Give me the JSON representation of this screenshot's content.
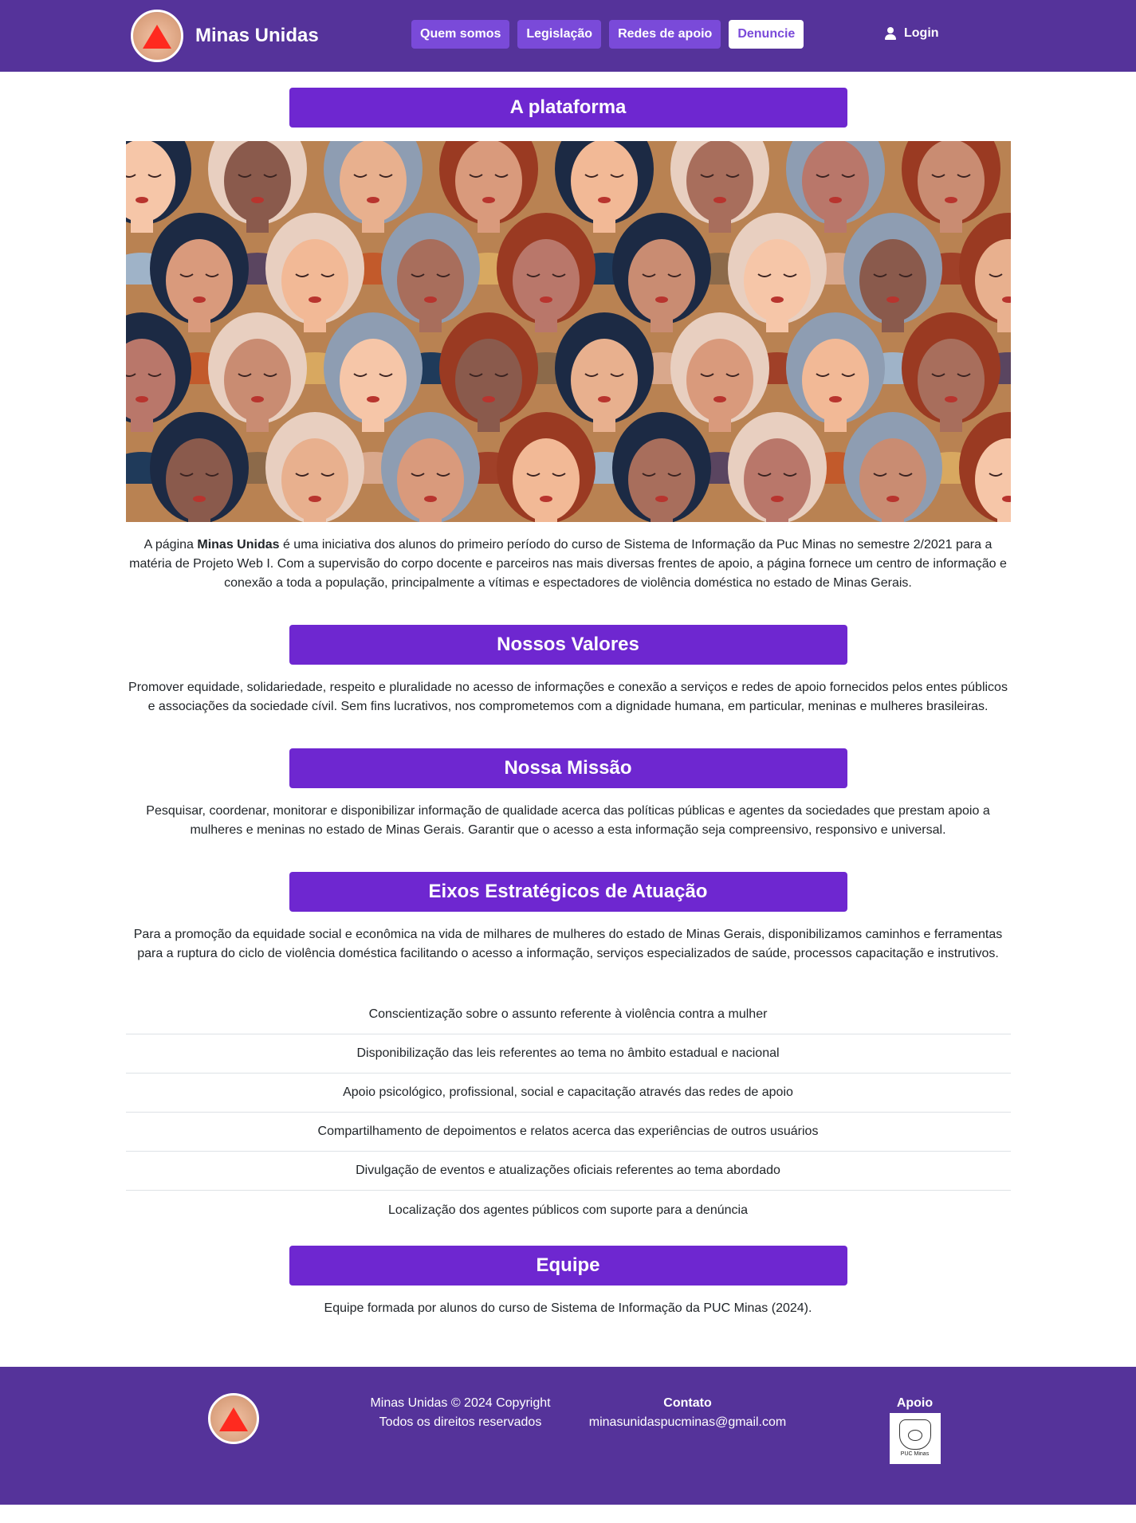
{
  "nav": {
    "brand": "Minas Unidas",
    "links": [
      "Quem somos",
      "Legislação",
      "Redes de apoio",
      "Denuncie"
    ],
    "login": "Login"
  },
  "sections": {
    "platform": {
      "title": "A plataforma",
      "text_prefix": "A página ",
      "text_bold": "Minas Unidas",
      "text_rest": " é uma iniciativa dos alunos do primeiro período do curso de Sistema de Informação da Puc Minas no semestre 2/2021 para a matéria de Projeto Web I. Com a supervisão do corpo docente e parceiros nas mais diversas frentes de apoio, a página fornece um centro de informação e conexão a toda a população, principalmente a vítimas e espectadores de violência doméstica no estado de Minas Gerais."
    },
    "values": {
      "title": "Nossos Valores",
      "text": "Promover equidade, solidariedade, respeito e pluralidade no acesso de informações e conexão a serviços e redes de apoio fornecidos pelos entes públicos e associações da sociedade cívil. Sem fins lucrativos, nos comprometemos com a dignidade humana, em particular, meninas e mulheres brasileiras."
    },
    "mission": {
      "title": "Nossa Missão",
      "text": "Pesquisar, coordenar, monitorar e disponibilizar informação de qualidade acerca das políticas públicas e agentes da sociedades que prestam apoio a mulheres e meninas no estado de Minas Gerais. Garantir que o acesso a esta informação seja compreensivo, responsivo e universal."
    },
    "axes": {
      "title": "Eixos Estratégicos de Atuação",
      "text": "Para a promoção da equidade social e econômica na vida de milhares de mulheres do estado de Minas Gerais, disponibilizamos caminhos e ferramentas para a ruptura do ciclo de violência doméstica facilitando o acesso a informação, serviços especializados de saúde, processos capacitação e instrutivos.",
      "items": [
        "Conscientização sobre o assunto referente à violência contra a mulher",
        "Disponibilização das leis referentes ao tema no âmbito estadual e nacional",
        "Apoio psicológico, profissional, social e capacitação através das redes de apoio",
        "Compartilhamento de depoimentos e relatos acerca das experiências de outros usuários",
        "Divulgação de eventos e atualizações oficiais referentes ao tema abordado",
        "Localização dos agentes públicos com suporte para a denúncia"
      ]
    },
    "team": {
      "title": "Equipe",
      "text": "Equipe formada por alunos do curso de Sistema de Informação da PUC Minas (2024)."
    }
  },
  "footer": {
    "copyright": "Minas Unidas © 2024 Copyright",
    "rights": "Todos os direitos reservados",
    "contact_title": "Contato",
    "contact_email": "minasunidaspucminas@gmail.com",
    "support_title": "Apoio",
    "support_logo_text": "PUC Minas"
  },
  "colors": {
    "navbar": "#55339a",
    "section_title": "#6e27d0",
    "nav_button": "#7a4ad9"
  },
  "icons": [
    "user-icon",
    "brand-logo",
    "puc-minas-seal"
  ]
}
